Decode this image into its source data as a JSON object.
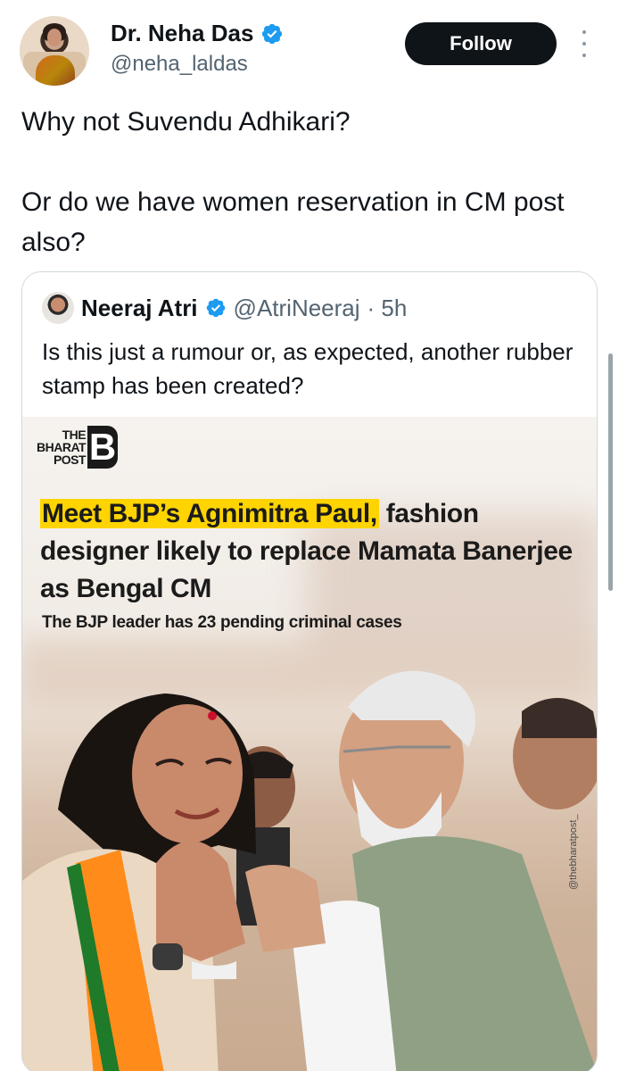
{
  "tweet": {
    "author": {
      "display_name": "Dr. Neha Das",
      "handle": "@neha_laldas",
      "verified": true
    },
    "follow_label": "Follow",
    "more_icon": "more-vertical-icon",
    "text_lines": [
      "Why not Suvendu Adhikari?",
      "Or do we have women reservation in CM post also?"
    ]
  },
  "quoted_tweet": {
    "author": {
      "display_name": "Neeraj Atri",
      "handle": "@AtriNeeraj",
      "time": "· 5h",
      "verified": true
    },
    "text": "Is this just a rumour or, as expected, another rubber stamp has been created?",
    "media": {
      "logo": {
        "line1": "THE",
        "line2": "BHARAT",
        "line3": "POST",
        "mark": "B"
      },
      "headline_highlight": "Meet BJP’s Agnimitra Paul,",
      "headline_rest": " fashion designer likely to replace Mamata Banerjee as Bengal CM",
      "subhead": "The BJP leader has 23 pending criminal cases",
      "watermark": "@thebharatpost_"
    }
  },
  "colors": {
    "verified_blue": "#1d9bf0",
    "follow_bg": "#0f1419",
    "highlight": "#ffd400",
    "secondary_text": "#536471"
  }
}
